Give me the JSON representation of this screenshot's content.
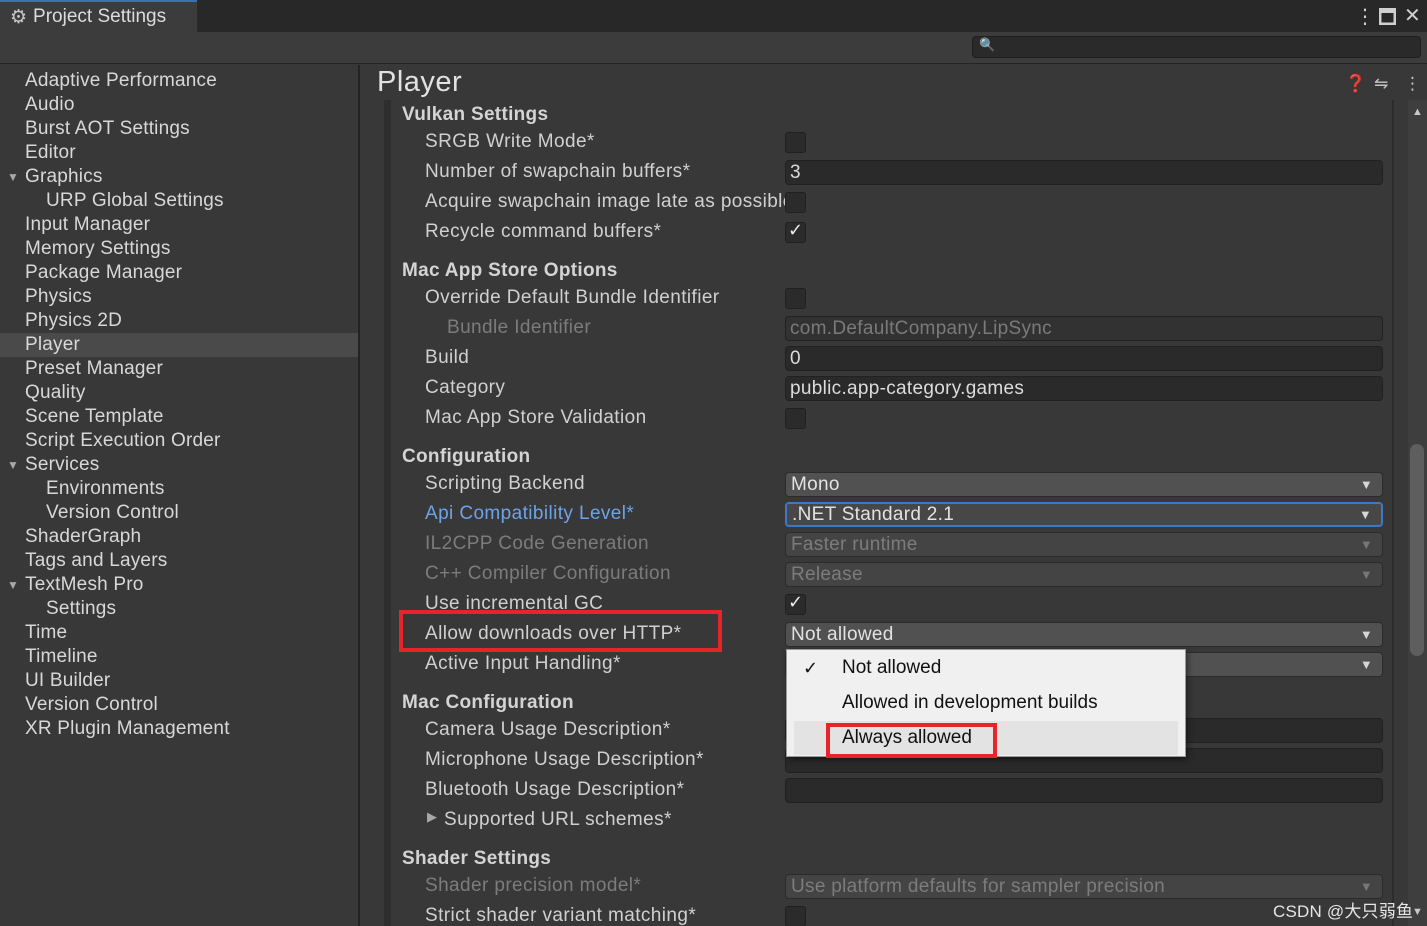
{
  "window": {
    "tab_title": "Project Settings",
    "tab_icon": "gear-icon"
  },
  "search": {
    "placeholder": ""
  },
  "sidebar": {
    "items": [
      {
        "label": "Adaptive Performance"
      },
      {
        "label": "Audio"
      },
      {
        "label": "Burst AOT Settings"
      },
      {
        "label": "Editor"
      },
      {
        "label": "Graphics",
        "expanded": true
      },
      {
        "label": "URP Global Settings",
        "child": true
      },
      {
        "label": "Input Manager"
      },
      {
        "label": "Memory Settings"
      },
      {
        "label": "Package Manager"
      },
      {
        "label": "Physics"
      },
      {
        "label": "Physics 2D"
      },
      {
        "label": "Player",
        "selected": true
      },
      {
        "label": "Preset Manager"
      },
      {
        "label": "Quality"
      },
      {
        "label": "Scene Template"
      },
      {
        "label": "Script Execution Order"
      },
      {
        "label": "Services",
        "expanded": true
      },
      {
        "label": "Environments",
        "child": true
      },
      {
        "label": "Version Control",
        "child": true
      },
      {
        "label": "ShaderGraph"
      },
      {
        "label": "Tags and Layers"
      },
      {
        "label": "TextMesh Pro",
        "expanded": true
      },
      {
        "label": "Settings",
        "child": true
      },
      {
        "label": "Time"
      },
      {
        "label": "Timeline"
      },
      {
        "label": "UI Builder"
      },
      {
        "label": "Version Control"
      },
      {
        "label": "XR Plugin Management"
      }
    ]
  },
  "main": {
    "title": "Player",
    "vulkan": {
      "header": "Vulkan Settings",
      "srgb_label": "SRGB Write Mode*",
      "srgb_checked": false,
      "swapchain_label": "Number of swapchain buffers*",
      "swapchain_value": "3",
      "acquire_label": "Acquire swapchain image late as possible*",
      "acquire_checked": false,
      "recycle_label": "Recycle command buffers*",
      "recycle_checked": true
    },
    "mac_store": {
      "header": "Mac App Store Options",
      "override_label": "Override Default Bundle Identifier",
      "bundle_label": "Bundle Identifier",
      "bundle_value": "com.DefaultCompany.LipSync",
      "build_label": "Build",
      "build_value": "0",
      "category_label": "Category",
      "category_value": "public.app-category.games",
      "validation_label": "Mac App Store Validation"
    },
    "configuration": {
      "header": "Configuration",
      "scripting_label": "Scripting Backend",
      "scripting_value": "Mono",
      "api_label": "Api Compatibility Level*",
      "api_value": ".NET Standard 2.1",
      "il2cpp_label": "IL2CPP Code Generation",
      "il2cpp_value": "Faster runtime",
      "cpp_label": "C++ Compiler Configuration",
      "cpp_value": "Release",
      "incgc_label": "Use incremental GC",
      "incgc_checked": true,
      "http_label": "Allow downloads over HTTP*",
      "http_value": "Not allowed",
      "input_label": "Active Input Handling*"
    },
    "mac_config": {
      "header": "Mac Configuration",
      "camera_label": "Camera Usage Description*",
      "mic_label": "Microphone Usage Description*",
      "bluetooth_label": "Bluetooth Usage Description*",
      "url_label": "Supported URL schemes*"
    },
    "shader": {
      "header": "Shader Settings",
      "precision_label": "Shader precision model*",
      "precision_value": "Use platform defaults for sampler precision",
      "strict_label": "Strict shader variant matching*"
    }
  },
  "popup": {
    "options": [
      "Not allowed",
      "Allowed in development builds",
      "Always allowed"
    ],
    "selected": "Not allowed",
    "highlighted": "Always allowed"
  },
  "watermark": "CSDN @大只弱鱼",
  "colors": {
    "highlight_box": "#e8232a",
    "link": "#6ea3e6",
    "focus": "#3b7ac6"
  }
}
